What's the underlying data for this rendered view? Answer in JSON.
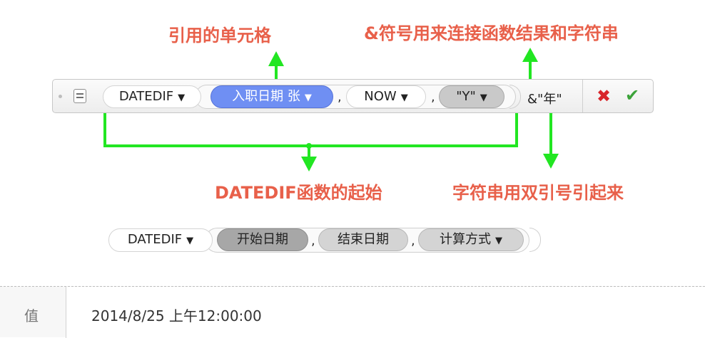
{
  "annotations": {
    "cell_ref": "引用的单元格",
    "concat": "&符号用来连接函数结果和字符串",
    "datedif_start": "DATEDIF函数的起始",
    "string_quotes": "字符串用双引号引起来"
  },
  "formula": {
    "function": "DATEDIF",
    "arg1": "入职日期 张",
    "arg2": "NOW",
    "arg3": "\"Y\"",
    "separator": ",",
    "suffix": "&\"年\""
  },
  "syntax": {
    "function": "DATEDIF",
    "arg1": "开始日期",
    "arg2": "结束日期",
    "arg3": "计算方式",
    "separator": ","
  },
  "icons": {
    "dropdown": "▼",
    "cancel": "✖",
    "confirm": "✔"
  },
  "result": {
    "label": "值",
    "value": "2014/8/25 上午12:00:00"
  },
  "colors": {
    "annotation_text": "#e8604a",
    "annotation_arrow": "#22e622",
    "token_blue": "#6f8ff3",
    "cancel": "#d8262b",
    "confirm": "#3ca33a"
  }
}
